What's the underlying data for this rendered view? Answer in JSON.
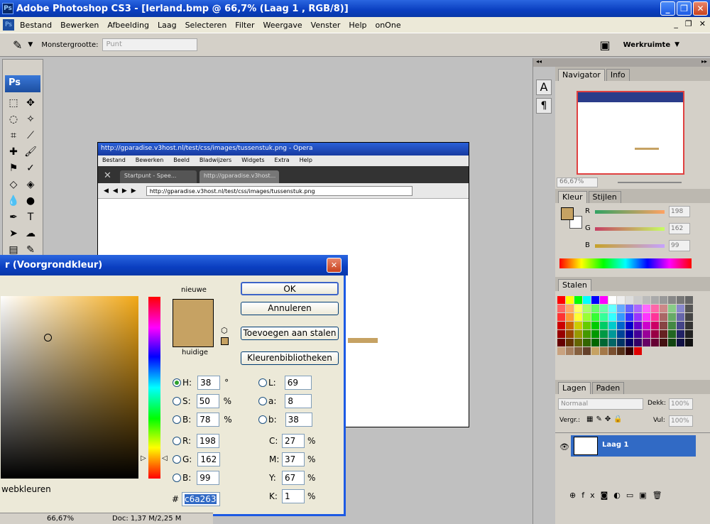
{
  "window": {
    "title": "Adobe Photoshop CS3 - [Ierland.bmp @ 66,7% (Laag 1 , RGB/8)]",
    "app_icon": "Ps"
  },
  "menu": [
    "Bestand",
    "Bewerken",
    "Afbeelding",
    "Laag",
    "Selecteren",
    "Filter",
    "Weergave",
    "Venster",
    "Help",
    "onOne"
  ],
  "options": {
    "sample_label": "Monstergrootte:",
    "sample_value": "Punt",
    "workspace": "Werkruimte"
  },
  "toolbox": {
    "logo": "Ps"
  },
  "opera": {
    "title": "http://gparadise.v3host.nl/test/css/images/tussenstuk.png - Opera",
    "menu": [
      "Bestand",
      "Bewerken",
      "Beeld",
      "Bladwijzers",
      "Widgets",
      "Extra",
      "Help"
    ],
    "tabs": [
      "Startpunt - Spee...",
      "http://gparadise.v3host..."
    ],
    "url": "http://gparadise.v3host.nl/test/css/images/tussenstuk.png"
  },
  "dialog": {
    "title": "r (Voorgrondkleur)",
    "new_label": "nieuwe",
    "current_label": "huidige",
    "buttons": {
      "ok": "OK",
      "cancel": "Annuleren",
      "add": "Toevoegen aan stalen",
      "lib": "Kleurenbibliotheken"
    },
    "web_label": "webkleuren",
    "hsb": [
      {
        "k": "H:",
        "v": "38",
        "u": "°"
      },
      {
        "k": "S:",
        "v": "50",
        "u": "%"
      },
      {
        "k": "B:",
        "v": "78",
        "u": "%"
      }
    ],
    "rgb": [
      {
        "k": "R:",
        "v": "198"
      },
      {
        "k": "G:",
        "v": "162"
      },
      {
        "k": "B:",
        "v": "99"
      }
    ],
    "lab": [
      {
        "k": "L:",
        "v": "69"
      },
      {
        "k": "a:",
        "v": "8"
      },
      {
        "k": "b:",
        "v": "38"
      }
    ],
    "cmyk": [
      {
        "k": "C:",
        "v": "27",
        "u": "%"
      },
      {
        "k": "M:",
        "v": "37",
        "u": "%"
      },
      {
        "k": "Y:",
        "v": "67",
        "u": "%"
      },
      {
        "k": "K:",
        "v": "1",
        "u": "%"
      }
    ],
    "hex_label": "#",
    "hex": "c6a263"
  },
  "navigator": {
    "tabs": [
      "Navigator",
      "Info"
    ],
    "zoom": "66,67%"
  },
  "color": {
    "tabs": [
      "Kleur",
      "Stijlen"
    ],
    "r": "198",
    "g": "162",
    "b": "99",
    "labels": [
      "R",
      "G",
      "B"
    ]
  },
  "swatches": {
    "tabs": [
      "Stalen"
    ]
  },
  "layers": {
    "tabs": [
      "Lagen",
      "Paden"
    ],
    "mode": "Normaal",
    "opacity_label": "Dekk:",
    "opacity": "100%",
    "lock_label": "Vergr.:",
    "fill_label": "Vul:",
    "fill": "100%",
    "layer_name": "Laag 1"
  },
  "status": {
    "zoom": "66,67%",
    "doc": "Doc: 1,37 M/2,25 M"
  },
  "accent": "#c6a263"
}
